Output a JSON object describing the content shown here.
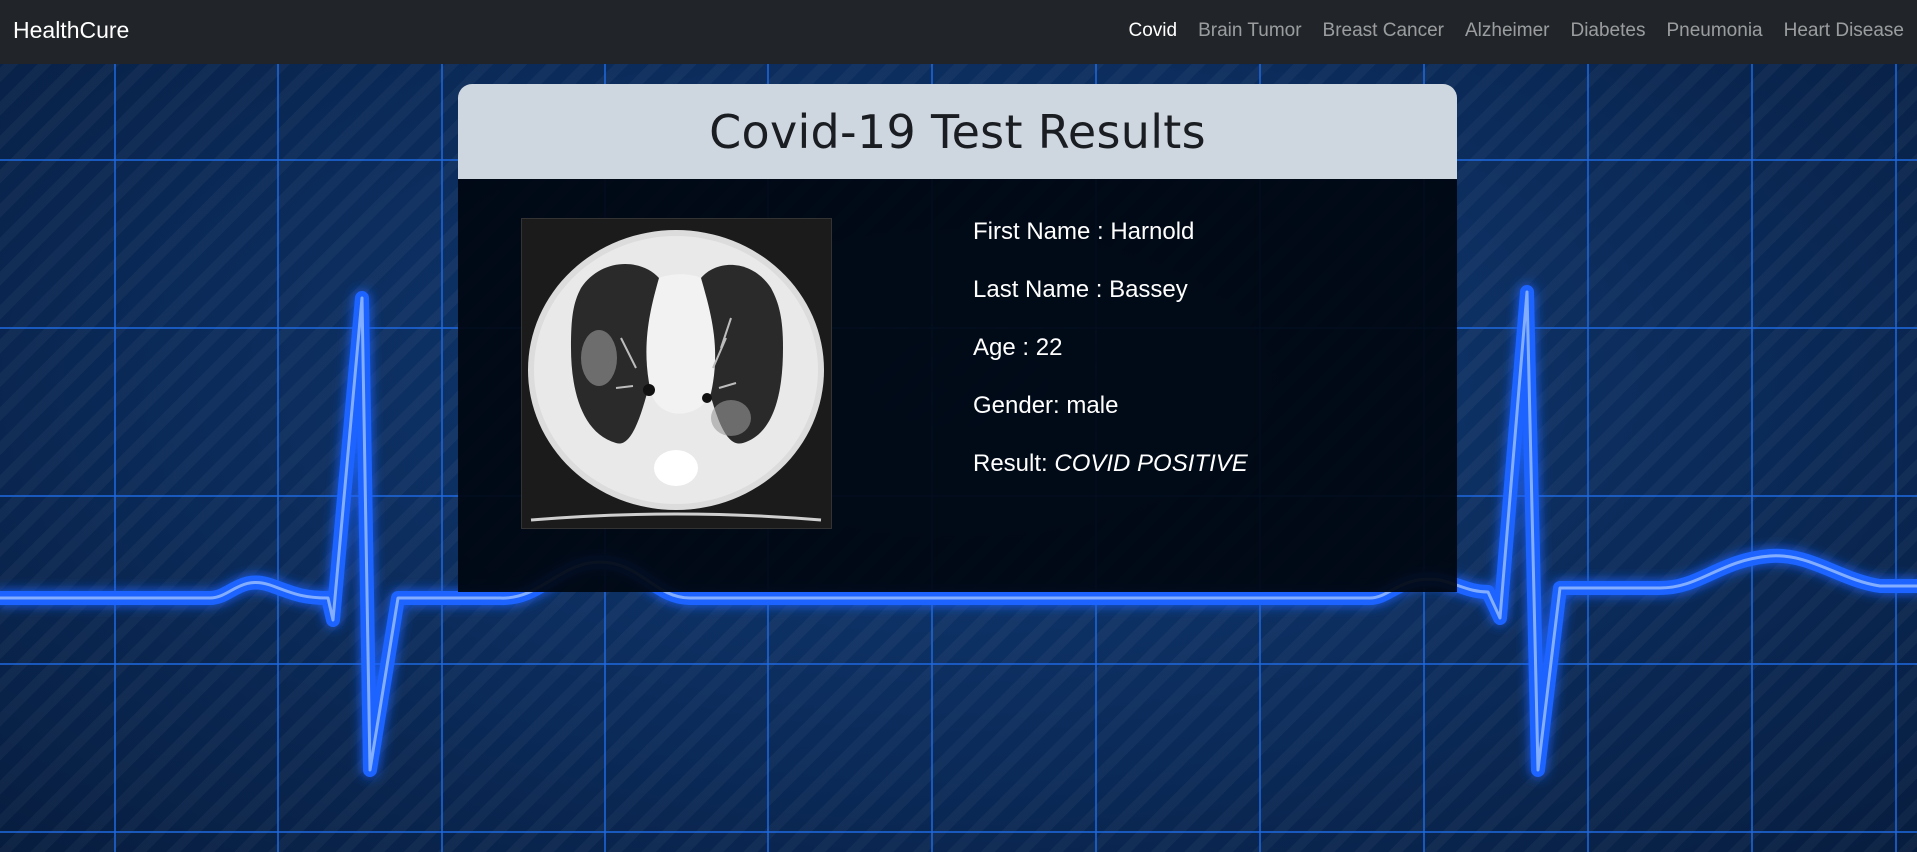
{
  "navbar": {
    "brand": "HealthCure",
    "links": [
      {
        "label": "Covid",
        "active": true
      },
      {
        "label": "Brain Tumor",
        "active": false
      },
      {
        "label": "Breast Cancer",
        "active": false
      },
      {
        "label": "Alzheimer",
        "active": false
      },
      {
        "label": "Diabetes",
        "active": false
      },
      {
        "label": "Pneumonia",
        "active": false
      },
      {
        "label": "Heart Disease",
        "active": false
      }
    ]
  },
  "card": {
    "title": "Covid-19 Test Results",
    "patient": {
      "first_name_label": "First Name : ",
      "first_name": "Harnold",
      "last_name_label": "Last Name : ",
      "last_name": "Bassey",
      "age_label": "Age : ",
      "age": "22",
      "gender_label": "Gender: ",
      "gender": "male",
      "result_label": "Result: ",
      "result": "COVID POSITIVE"
    },
    "image": {
      "icon": "lung-ct-scan-image"
    }
  },
  "colors": {
    "navbar_bg": "#212529",
    "header_bg": "#ced6e0",
    "ecg_line": "#2a6fff",
    "background": "#0b2a57"
  }
}
